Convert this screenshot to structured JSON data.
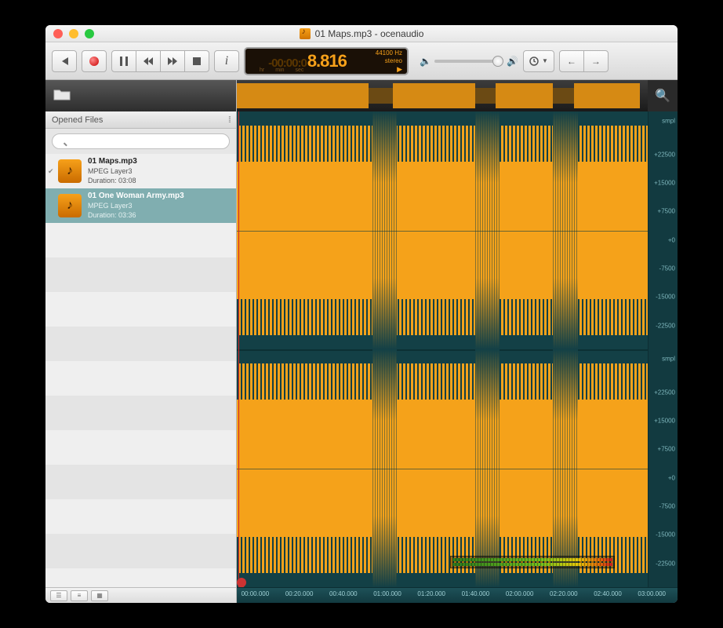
{
  "title": "01 Maps.mp3 - ocenaudio",
  "lcd": {
    "prefix": "-00:00:0",
    "main": "8.816",
    "units": [
      "hr",
      "min",
      "sec"
    ],
    "sample_rate": "44100 Hz",
    "channels": "stereo"
  },
  "sidebar": {
    "header": "Opened Files",
    "search_placeholder": "",
    "files": [
      {
        "name": "01 Maps.mp3",
        "codec": "MPEG Layer3",
        "duration": "Duration: 03:08",
        "selected": false,
        "checked": true
      },
      {
        "name": "01 One Woman Army.mp3",
        "codec": "MPEG Layer3",
        "duration": "Duration: 03:36",
        "selected": true,
        "checked": false
      }
    ]
  },
  "scale": {
    "ch_label": "smpl",
    "ticks": [
      "+22500",
      "+15000",
      "+7500",
      "+0",
      "-7500",
      "-15000",
      "-22500"
    ]
  },
  "timeline": [
    "00:00.000",
    "00:20.000",
    "00:40.000",
    "01:00.000",
    "01:20.000",
    "01:40.000",
    "02:00.000",
    "02:20.000",
    "02:40.000",
    "03:00.000"
  ]
}
